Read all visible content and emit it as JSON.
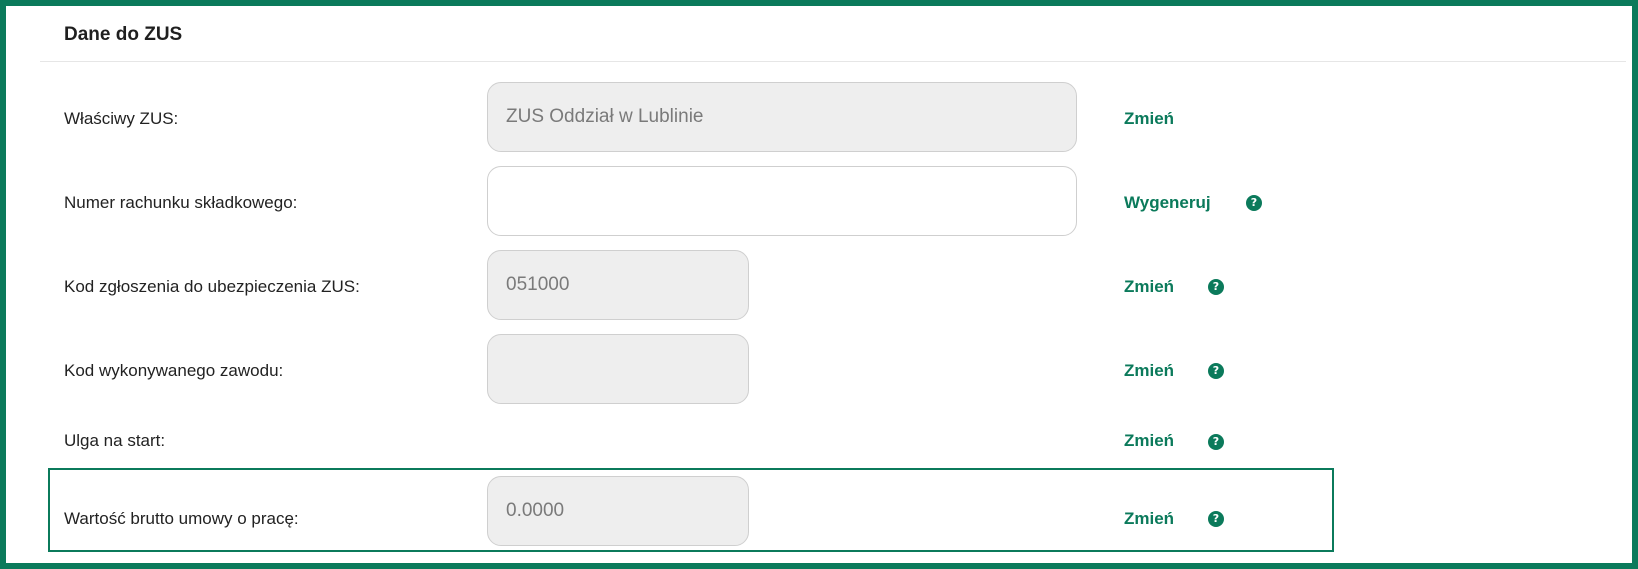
{
  "section": {
    "title": "Dane do ZUS"
  },
  "fields": [
    {
      "label": "Właściwy ZUS:",
      "value": "ZUS Oddział w Lublinie",
      "placeholder": "",
      "action": "Zmień",
      "help_icon": false
    },
    {
      "label": "Numer rachunku składkowego:",
      "value": "",
      "placeholder": "",
      "action": "Wygeneruj",
      "help_icon": true
    },
    {
      "label": "Kod zgłoszenia do ubezpieczenia ZUS:",
      "value": "051000",
      "placeholder": "",
      "action": "Zmień",
      "help_icon": true
    },
    {
      "label": "Kod wykonywanego zawodu:",
      "value": "",
      "placeholder": "",
      "action": "Zmień",
      "help_icon": true
    },
    {
      "label": "Ulga na start:",
      "action": "Zmień",
      "help_icon": true
    },
    {
      "label": "Wartość brutto umowy o pracę:",
      "value": "0.0000",
      "placeholder": "",
      "action": "Zmień",
      "help_icon": true,
      "highlighted": true
    }
  ],
  "help_icon_glyph": "?",
  "colors": {
    "accent": "#0b7a5b",
    "input_disabled_bg": "#eeeeee",
    "border": "#cfcfcf"
  }
}
